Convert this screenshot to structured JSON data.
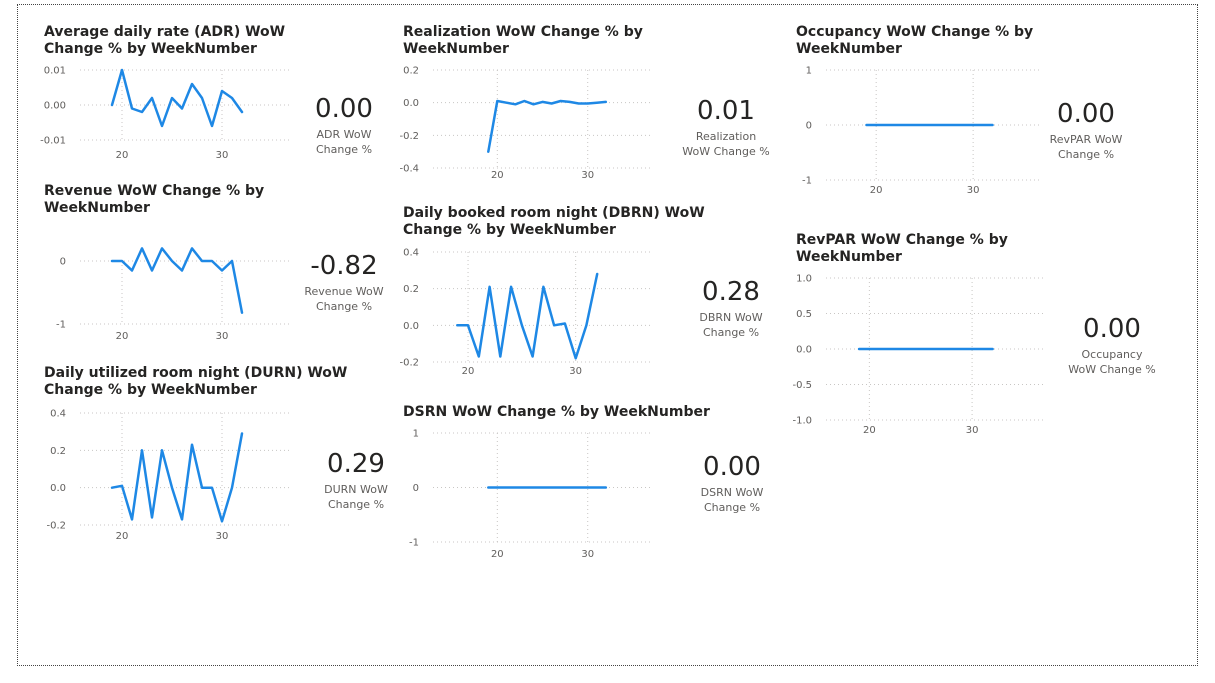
{
  "colors": {
    "line": "#1e88e5",
    "grid": "#c8c6c4"
  },
  "panels": [
    {
      "id": "adr",
      "title": "Average daily rate (ADR) WoW\nChange % by WeekNumber",
      "kpi_value": "0.00",
      "kpi_label": "ADR WoW\nChange %"
    },
    {
      "id": "realization",
      "title": "Realization WoW Change % by\nWeekNumber",
      "kpi_value": "0.01",
      "kpi_label": "Realization\nWoW Change %"
    },
    {
      "id": "occupancy",
      "title": "Occupancy WoW Change % by\nWeekNumber",
      "kpi_value": "0.00",
      "kpi_label": "RevPAR WoW\nChange %"
    },
    {
      "id": "revenue",
      "title": "Revenue WoW Change % by\nWeekNumber",
      "kpi_value": "-0.82",
      "kpi_label": "Revenue WoW\nChange %"
    },
    {
      "id": "dbrn",
      "title": "Daily booked room night (DBRN) WoW\nChange % by WeekNumber",
      "kpi_value": "0.28",
      "kpi_label": "DBRN WoW\nChange %"
    },
    {
      "id": "revpar",
      "title": "RevPAR WoW Change % by\nWeekNumber",
      "kpi_value": "0.00",
      "kpi_label": "Occupancy\nWoW Change %"
    },
    {
      "id": "durn",
      "title": "Daily utilized room night (DURN) WoW\nChange % by WeekNumber",
      "kpi_value": "0.29",
      "kpi_label": "DURN WoW\nChange %"
    },
    {
      "id": "dsrn",
      "title": "DSRN WoW Change % by WeekNumber",
      "kpi_value": "0.00",
      "kpi_label": "DSRN WoW\nChange %"
    }
  ],
  "chart_data": [
    {
      "id": "adr",
      "type": "line",
      "title": "Average daily rate (ADR) WoW Change % by WeekNumber",
      "x": [
        19,
        20,
        21,
        22,
        23,
        24,
        25,
        26,
        27,
        28,
        29,
        30,
        31,
        32
      ],
      "values": [
        0.0,
        0.01,
        -0.001,
        -0.002,
        0.002,
        -0.006,
        0.002,
        -0.001,
        0.006,
        0.002,
        -0.006,
        0.004,
        0.002,
        -0.002
      ],
      "yticks": [
        0.01,
        0.0,
        -0.01
      ],
      "ytick_labels": [
        "0.01",
        "0.00",
        "-0.01"
      ],
      "xticks": [
        20,
        30
      ],
      "xtick_labels": [
        "20",
        "30"
      ],
      "ylim": [
        -0.01,
        0.01
      ],
      "xlim": [
        15,
        37
      ]
    },
    {
      "id": "realization",
      "type": "line",
      "title": "Realization WoW Change % by WeekNumber",
      "x": [
        19,
        20,
        21,
        22,
        23,
        24,
        25,
        26,
        27,
        28,
        29,
        30,
        31,
        32
      ],
      "values": [
        -0.3,
        0.01,
        0.0,
        -0.01,
        0.01,
        -0.01,
        0.005,
        -0.005,
        0.01,
        0.005,
        -0.005,
        -0.005,
        0.0,
        0.005
      ],
      "yticks": [
        0.2,
        0.0,
        -0.2,
        -0.4
      ],
      "ytick_labels": [
        "0.2",
        "0.0",
        "-0.2",
        "-0.4"
      ],
      "xticks": [
        20,
        30
      ],
      "xtick_labels": [
        "20",
        "30"
      ],
      "ylim": [
        -0.4,
        0.2
      ],
      "xlim": [
        12,
        37
      ]
    },
    {
      "id": "occupancy",
      "type": "line",
      "title": "Occupancy WoW Change % by WeekNumber",
      "x": [
        19,
        20,
        21,
        22,
        23,
        24,
        25,
        26,
        27,
        28,
        29,
        30,
        31,
        32
      ],
      "values": [
        0,
        0,
        0,
        0,
        0,
        0,
        0,
        0,
        0,
        0,
        0,
        0,
        0,
        0
      ],
      "yticks": [
        1,
        0,
        -1
      ],
      "ytick_labels": [
        "1",
        "0",
        "-1"
      ],
      "xticks": [
        20,
        30
      ],
      "xtick_labels": [
        "20",
        "30"
      ],
      "ylim": [
        -1,
        1
      ],
      "xlim": [
        14,
        37
      ]
    },
    {
      "id": "revenue",
      "type": "line",
      "title": "Revenue WoW Change % by WeekNumber",
      "x": [
        19,
        20,
        21,
        22,
        23,
        24,
        25,
        26,
        27,
        28,
        29,
        30,
        31,
        32
      ],
      "values": [
        0.0,
        0.0,
        -0.15,
        0.2,
        -0.15,
        0.2,
        0.0,
        -0.15,
        0.2,
        0.0,
        0.0,
        -0.15,
        0.0,
        -0.82
      ],
      "yticks": [
        0,
        -1
      ],
      "ytick_labels": [
        "0",
        "-1"
      ],
      "xticks": [
        20,
        30
      ],
      "xtick_labels": [
        "20",
        "30"
      ],
      "ylim": [
        -1,
        0
      ],
      "xlim": [
        15,
        37
      ]
    },
    {
      "id": "dbrn",
      "type": "line",
      "title": "Daily booked room night (DBRN) WoW Change % by WeekNumber",
      "x": [
        19,
        20,
        21,
        22,
        23,
        24,
        25,
        26,
        27,
        28,
        29,
        30,
        31,
        32
      ],
      "values": [
        0.0,
        0.0,
        -0.17,
        0.21,
        -0.17,
        0.21,
        0.0,
        -0.17,
        0.21,
        0.0,
        0.01,
        -0.18,
        0.0,
        0.28
      ],
      "yticks": [
        0.4,
        0.2,
        0.0,
        -0.2
      ],
      "ytick_labels": [
        "0.4",
        "0.2",
        "0.0",
        "-0.2"
      ],
      "xticks": [
        20,
        30
      ],
      "xtick_labels": [
        "20",
        "30"
      ],
      "ylim": [
        -0.2,
        0.4
      ],
      "xlim": [
        16,
        37
      ]
    },
    {
      "id": "revpar",
      "type": "line",
      "title": "RevPAR WoW Change % by WeekNumber",
      "x": [
        19,
        20,
        21,
        22,
        23,
        24,
        25,
        26,
        27,
        28,
        29,
        30,
        31,
        32
      ],
      "values": [
        0,
        0,
        0,
        0,
        0,
        0,
        0,
        0,
        0,
        0,
        0,
        0,
        0,
        0
      ],
      "yticks": [
        1.0,
        0.5,
        0.0,
        -0.5,
        -1.0
      ],
      "ytick_labels": [
        "1.0",
        "0.5",
        "0.0",
        "-0.5",
        "-1.0"
      ],
      "xticks": [
        20,
        30
      ],
      "xtick_labels": [
        "20",
        "30"
      ],
      "ylim": [
        -1,
        1
      ],
      "xlim": [
        15,
        37
      ]
    },
    {
      "id": "durn",
      "type": "line",
      "title": "Daily utilized room night (DURN) WoW Change % by WeekNumber",
      "x": [
        19,
        20,
        21,
        22,
        23,
        24,
        25,
        26,
        27,
        28,
        29,
        30,
        31,
        32
      ],
      "values": [
        0.0,
        0.01,
        -0.17,
        0.2,
        -0.16,
        0.2,
        0.0,
        -0.17,
        0.23,
        0.0,
        0.0,
        -0.18,
        0.0,
        0.29
      ],
      "yticks": [
        0.4,
        0.2,
        0.0,
        -0.2
      ],
      "ytick_labels": [
        "0.4",
        "0.2",
        "0.0",
        "-0.2"
      ],
      "xticks": [
        20,
        30
      ],
      "xtick_labels": [
        "20",
        "30"
      ],
      "ylim": [
        -0.2,
        0.4
      ],
      "xlim": [
        15,
        37
      ]
    },
    {
      "id": "dsrn",
      "type": "line",
      "title": "DSRN WoW Change % by WeekNumber",
      "x": [
        19,
        20,
        21,
        22,
        23,
        24,
        25,
        26,
        27,
        28,
        29,
        30,
        31,
        32
      ],
      "values": [
        0,
        0,
        0,
        0,
        0,
        0,
        0,
        0,
        0,
        0,
        0,
        0,
        0,
        0
      ],
      "yticks": [
        1,
        0,
        -1
      ],
      "ytick_labels": [
        "1",
        "0",
        "-1"
      ],
      "xticks": [
        20,
        30
      ],
      "xtick_labels": [
        "20",
        "30"
      ],
      "ylim": [
        -1,
        1
      ],
      "xlim": [
        12,
        37
      ]
    }
  ]
}
